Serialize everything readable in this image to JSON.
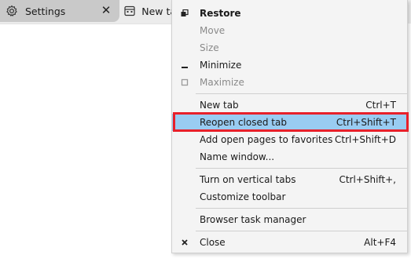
{
  "tabs": {
    "settings": {
      "label": "Settings",
      "icon": "gear-icon",
      "close_glyph": "✕"
    },
    "newtab": {
      "label": "New tab",
      "icon": "new-tab-page-icon"
    }
  },
  "menu": {
    "restore": {
      "label": "Restore",
      "icon": "restore-icon"
    },
    "move": {
      "label": "Move"
    },
    "size": {
      "label": "Size"
    },
    "minimize": {
      "label": "Minimize",
      "icon": "minimize-icon"
    },
    "maximize": {
      "label": "Maximize",
      "icon": "maximize-icon"
    },
    "new_tab": {
      "label": "New tab",
      "shortcut": "Ctrl+T"
    },
    "reopen_closed_tab": {
      "label": "Reopen closed tab",
      "shortcut": "Ctrl+Shift+T"
    },
    "add_to_favorites": {
      "label": "Add open pages to favorites",
      "shortcut": "Ctrl+Shift+D"
    },
    "name_window": {
      "label": "Name window..."
    },
    "vertical_tabs": {
      "label": "Turn on vertical tabs",
      "shortcut": "Ctrl+Shift+,"
    },
    "customize_toolbar": {
      "label": "Customize toolbar"
    },
    "task_manager": {
      "label": "Browser task manager"
    },
    "close": {
      "label": "Close",
      "shortcut": "Alt+F4",
      "icon": "close-icon"
    }
  },
  "colors": {
    "highlight": "#99ccf2",
    "annotation_frame": "#e8202a"
  }
}
